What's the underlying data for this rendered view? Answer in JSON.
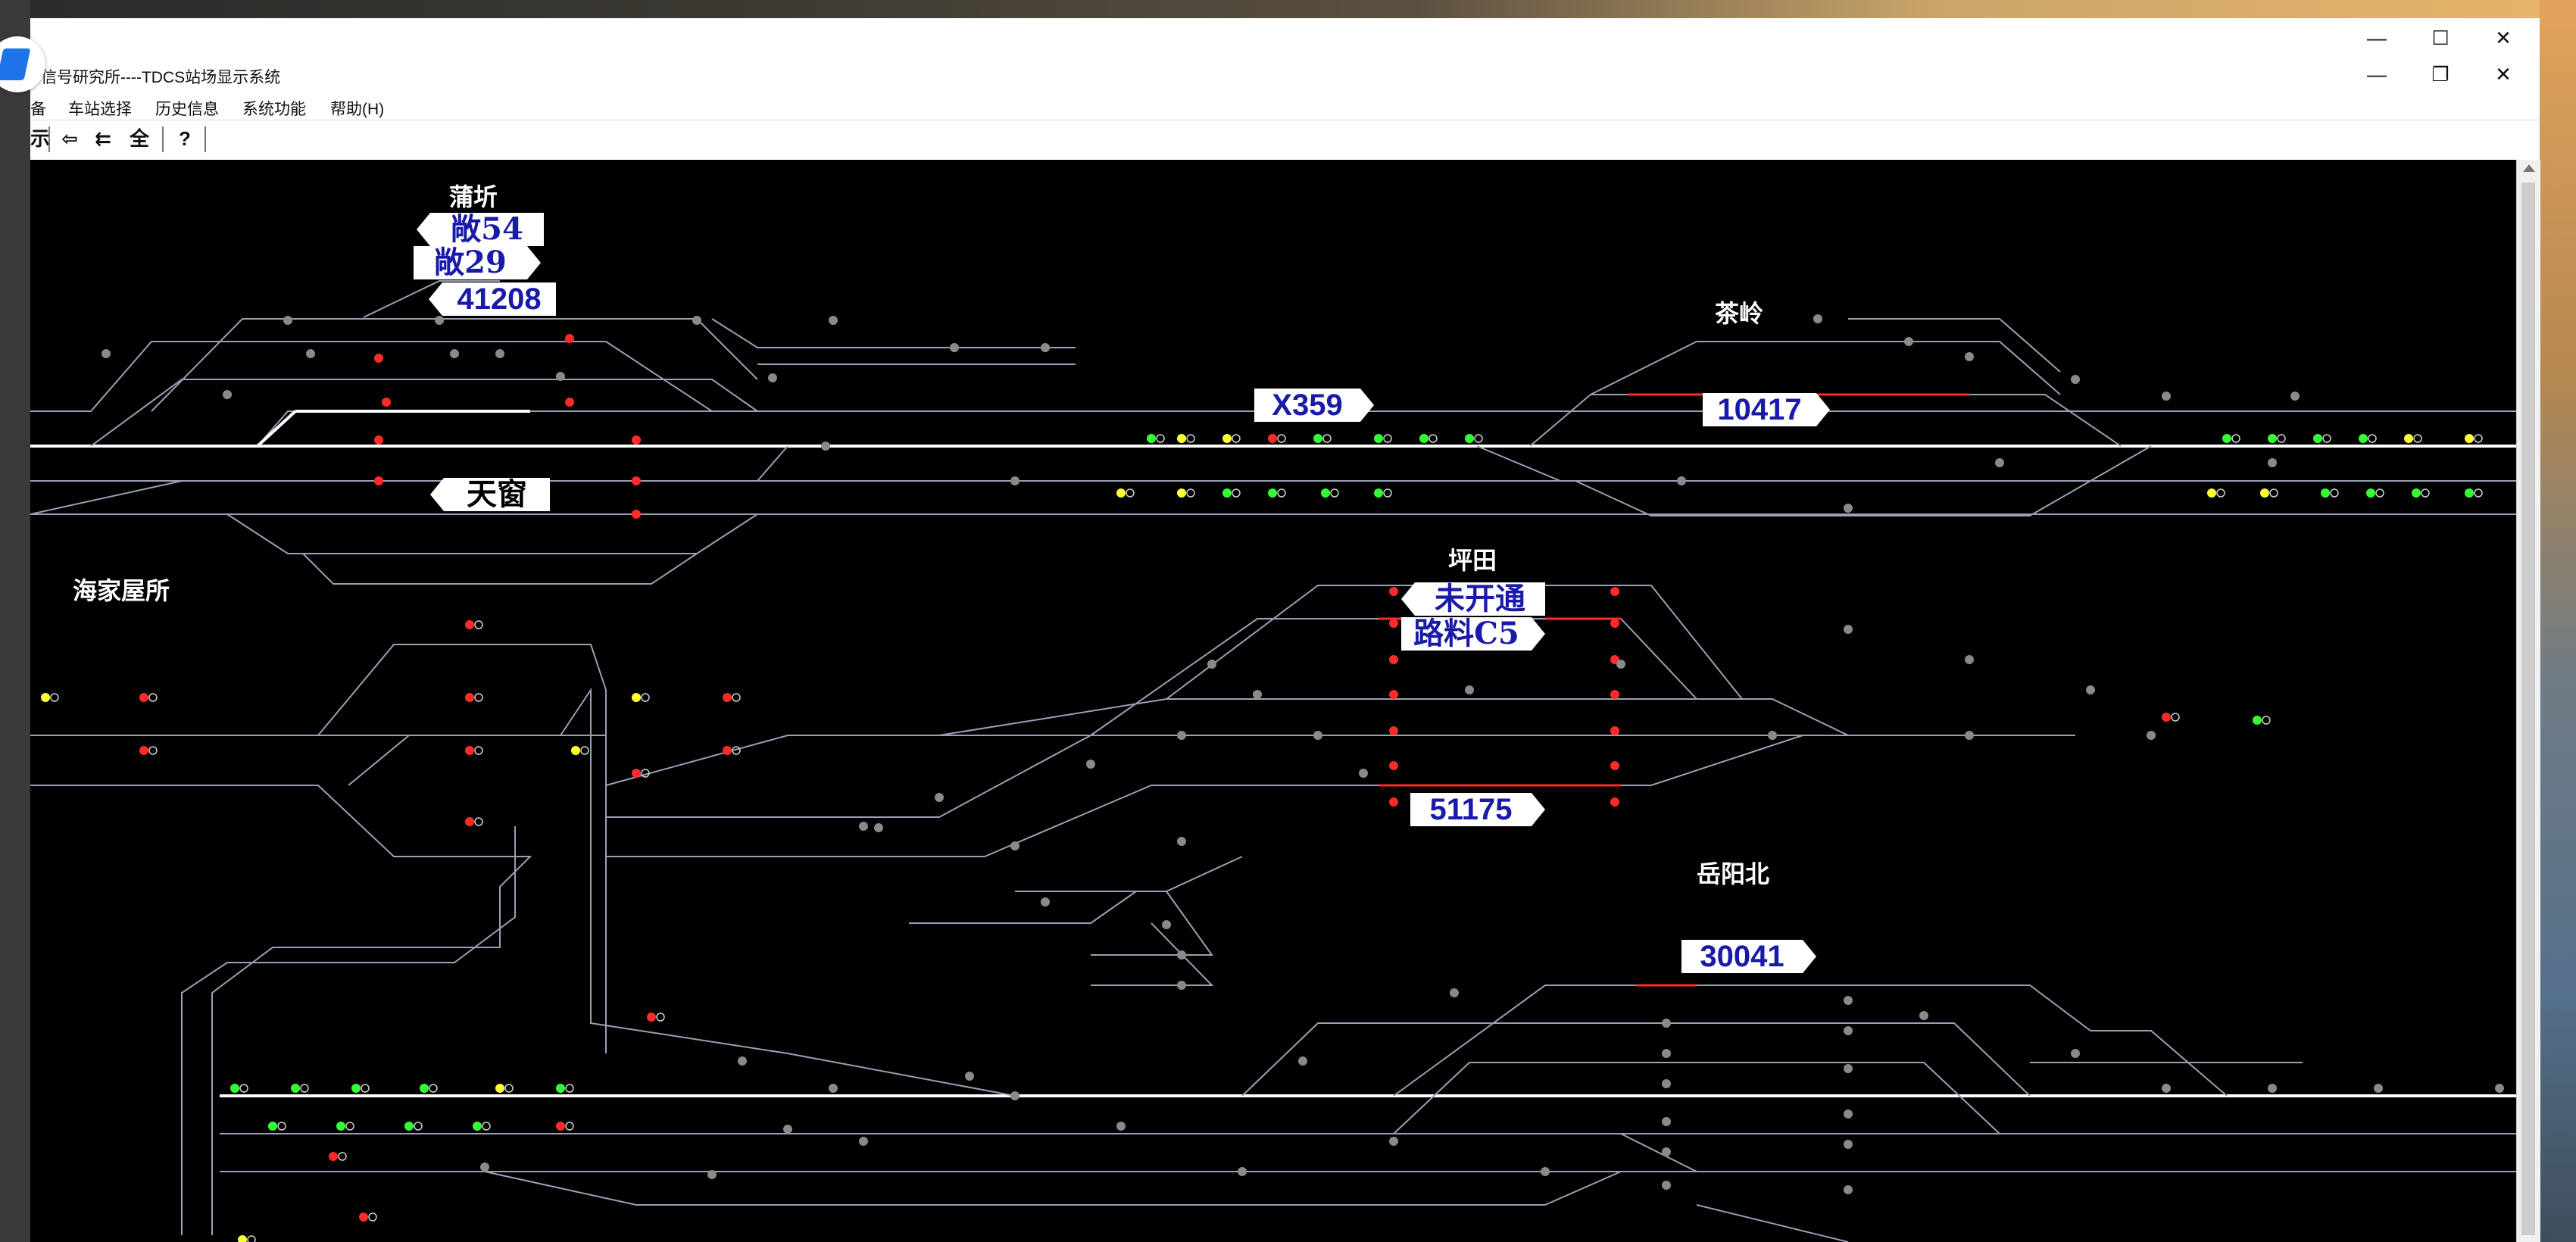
{
  "window": {
    "title": "信号研究所----TDCS站场显示系统",
    "controls": {
      "minimize": "—",
      "maximize": "☐",
      "close": "✕",
      "restore": "❐"
    }
  },
  "menu": {
    "items": [
      "备",
      "车站选择",
      "历史信息",
      "系统功能",
      "帮助(H)"
    ]
  },
  "toolbar": {
    "buttons": [
      "示",
      "⇦",
      "⇇",
      "全",
      "?"
    ]
  },
  "stations": {
    "pu_qi": "蒲圻",
    "cha_ling": "茶岭",
    "hai_jia_wu_suo": "海家屋所",
    "ping_tian": "坪田",
    "yueyang_bei": "岳阳北"
  },
  "train_tags": {
    "t1": "敞54",
    "t2": "敞29",
    "t3": "41208",
    "t4": "天窗",
    "t5": "X359",
    "t6": "10417",
    "t7": "未开通",
    "t8": "路料C5",
    "t9": "51175",
    "t10": "30041"
  },
  "colors": {
    "track": "#9aa0b5",
    "occupied": "#ff2a2a",
    "clear": "#ffffff",
    "signal_red": "#ff2a2a",
    "signal_green": "#34ff34",
    "signal_yellow": "#ffff33",
    "signal_grey": "#8a8a8a"
  }
}
